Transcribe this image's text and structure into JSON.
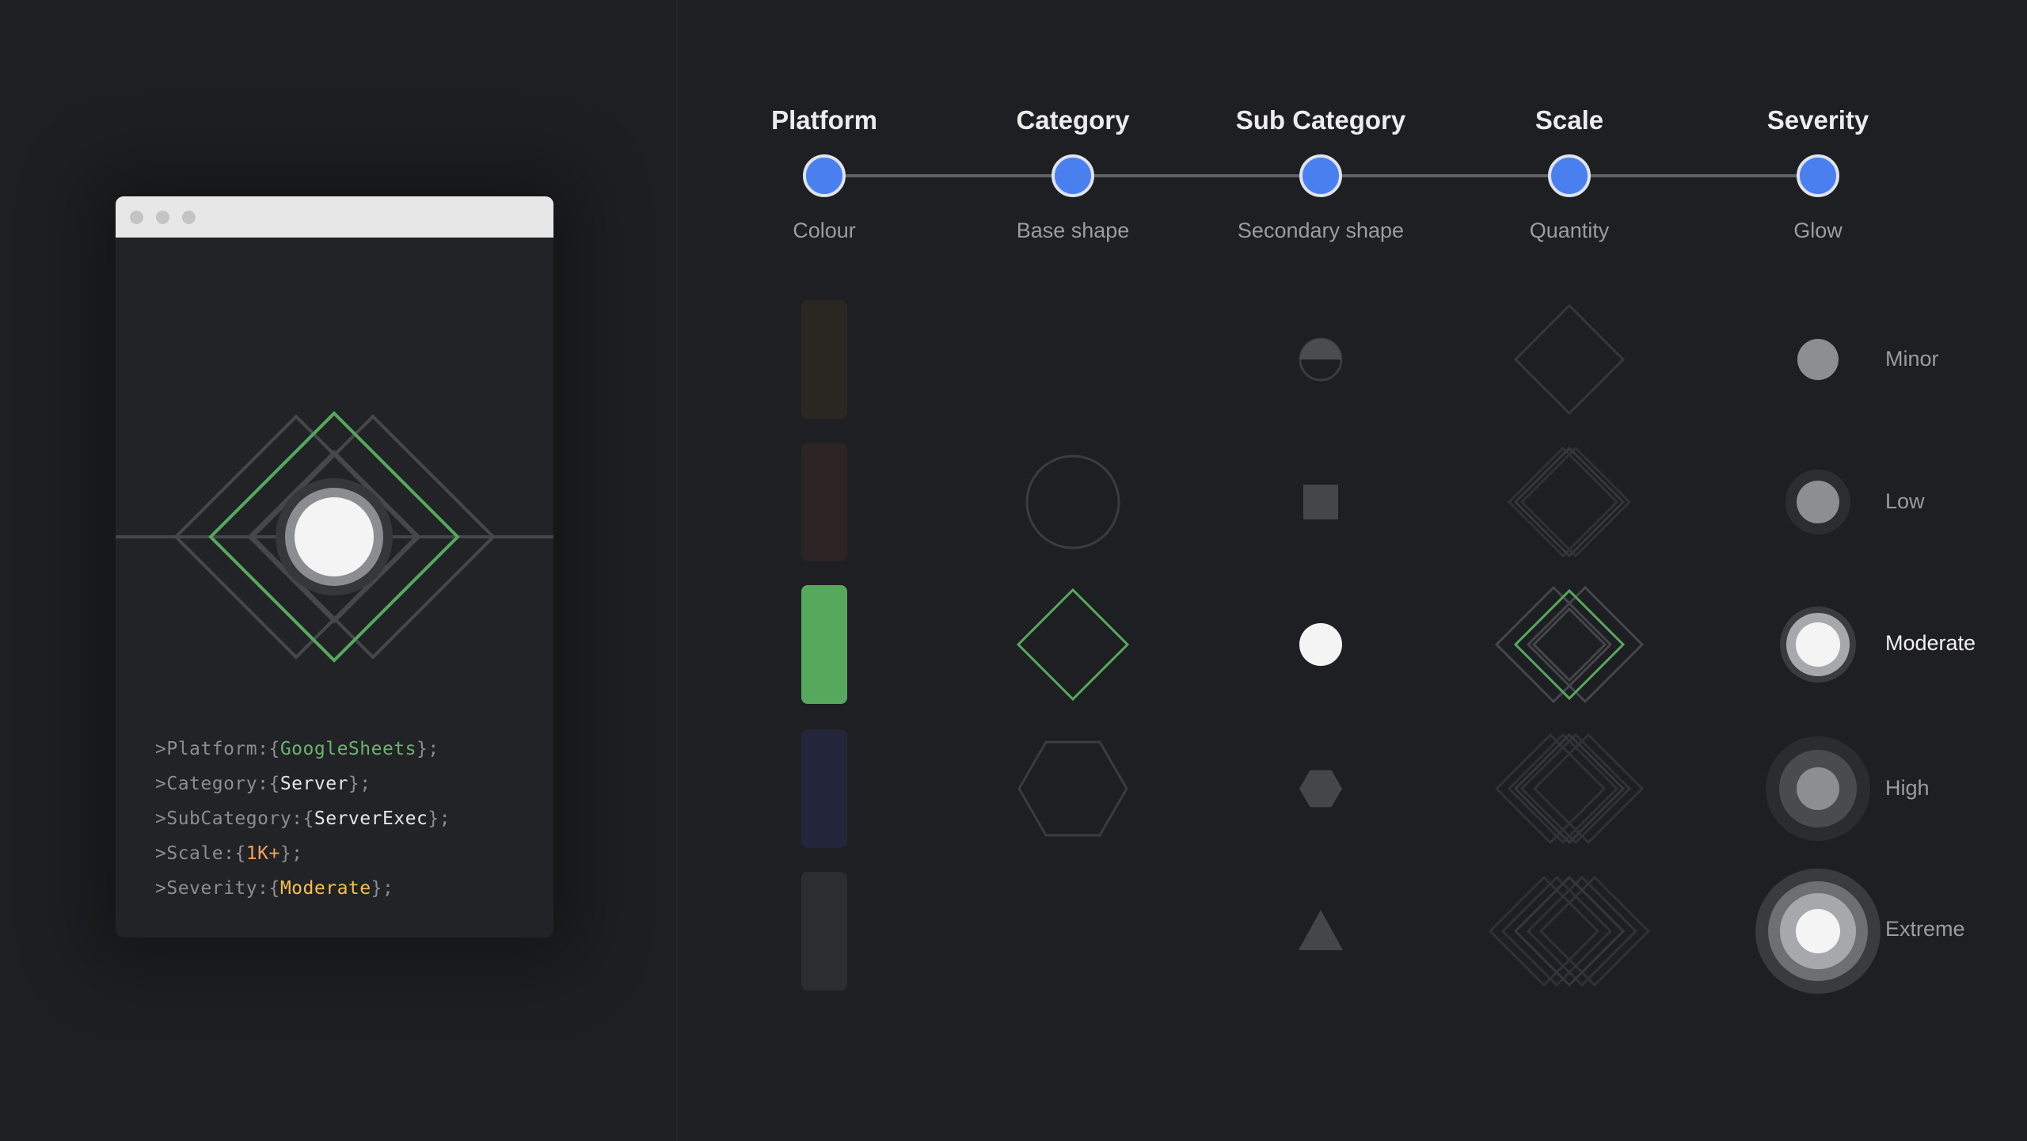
{
  "window": {
    "code_lines": [
      {
        "key": ">Platform:",
        "value": "GoogleSheets",
        "value_color": "#6ab36f"
      },
      {
        "key": ">Category:",
        "value": "Server",
        "value_color": "#e6e6e6"
      },
      {
        "key": ">SubCategory:",
        "value": "ServerExec",
        "value_color": "#e6e6e6"
      },
      {
        "key": ">Scale:",
        "value": "1K+",
        "value_color": "#f0a35a"
      },
      {
        "key": ">Severity:",
        "value": "Moderate",
        "value_color": "#f2c14e"
      }
    ],
    "punct": {
      "open": "{",
      "close": "};"
    }
  },
  "timeline": {
    "columns": [
      {
        "title": "Platform",
        "subtitle": "Colour"
      },
      {
        "title": "Category",
        "subtitle": "Base shape"
      },
      {
        "title": "Sub Category",
        "subtitle": "Secondary shape"
      },
      {
        "title": "Scale",
        "subtitle": "Quantity"
      },
      {
        "title": "Severity",
        "subtitle": "Glow"
      }
    ],
    "node_color": "#4a7ff0",
    "line_color": "#5f6166"
  },
  "legend": {
    "colour_swatches": [
      "#2a2622",
      "#2b2324",
      "#56a85d",
      "#23263a",
      "#2c2d30"
    ],
    "base_shapes": [
      "none",
      "circle",
      "diamond",
      "hexagon",
      "none"
    ],
    "secondary_shapes": [
      "half-circle",
      "square",
      "circle",
      "hexagon",
      "triangle"
    ],
    "quantity_levels": [
      1,
      2,
      3,
      4,
      5
    ],
    "severity": [
      {
        "label": "Minor",
        "active": false
      },
      {
        "label": "Low",
        "active": false
      },
      {
        "label": "Moderate",
        "active": true
      },
      {
        "label": "High",
        "active": false
      },
      {
        "label": "Extreme",
        "active": false
      }
    ],
    "highlight_color": "#56a85d",
    "dim_color": "#3b3c40"
  }
}
